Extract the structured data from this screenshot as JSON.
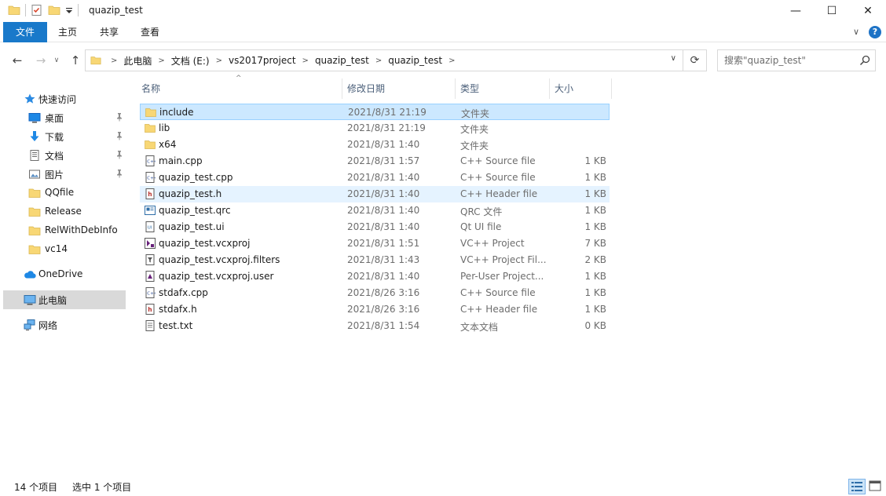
{
  "window": {
    "title": "quazip_test",
    "minimize": "—",
    "maximize": "☐",
    "close": "✕"
  },
  "ribbon": {
    "tabs": [
      "文件",
      "主页",
      "共享",
      "查看"
    ],
    "collapse_glyph": "∨",
    "help_glyph": "?"
  },
  "nav": {
    "back": "←",
    "forward": "→",
    "recent": "∨",
    "up": "↑",
    "refresh": "⟳",
    "address_dropdown": "∨",
    "breadcrumbs": [
      "此电脑",
      "文档 (E:)",
      "vs2017project",
      "quazip_test",
      "quazip_test"
    ],
    "search_placeholder": "搜索\"quazip_test\""
  },
  "sidebar": {
    "quick_access": "快速访问",
    "pinned": [
      {
        "label": "桌面",
        "icon": "desktop-icon"
      },
      {
        "label": "下载",
        "icon": "download-icon"
      },
      {
        "label": "文档",
        "icon": "documents-icon"
      },
      {
        "label": "图片",
        "icon": "pictures-icon"
      }
    ],
    "folders": [
      "QQfile",
      "Release",
      "RelWithDebInfo",
      "vc14"
    ],
    "onedrive": "OneDrive",
    "this_pc": "此电脑",
    "network": "网络"
  },
  "columns": {
    "name": "名称",
    "date": "修改日期",
    "type": "类型",
    "size": "大小"
  },
  "files": [
    {
      "name": "include",
      "date": "2021/8/31 21:19",
      "type": "文件夹",
      "size": "",
      "icon": "folder-icon"
    },
    {
      "name": "lib",
      "date": "2021/8/31 21:19",
      "type": "文件夹",
      "size": "",
      "icon": "folder-icon"
    },
    {
      "name": "x64",
      "date": "2021/8/31 1:40",
      "type": "文件夹",
      "size": "",
      "icon": "folder-icon"
    },
    {
      "name": "main.cpp",
      "date": "2021/8/31 1:57",
      "type": "C++ Source file",
      "size": "1 KB",
      "icon": "cpp-file-icon"
    },
    {
      "name": "quazip_test.cpp",
      "date": "2021/8/31 1:40",
      "type": "C++ Source file",
      "size": "1 KB",
      "icon": "cpp-file-icon"
    },
    {
      "name": "quazip_test.h",
      "date": "2021/8/31 1:40",
      "type": "C++ Header file",
      "size": "1 KB",
      "icon": "header-file-icon"
    },
    {
      "name": "quazip_test.qrc",
      "date": "2021/8/31 1:40",
      "type": "QRC 文件",
      "size": "1 KB",
      "icon": "qrc-file-icon"
    },
    {
      "name": "quazip_test.ui",
      "date": "2021/8/31 1:40",
      "type": "Qt UI file",
      "size": "1 KB",
      "icon": "ui-file-icon"
    },
    {
      "name": "quazip_test.vcxproj",
      "date": "2021/8/31 1:51",
      "type": "VC++ Project",
      "size": "7 KB",
      "icon": "vcxproj-file-icon"
    },
    {
      "name": "quazip_test.vcxproj.filters",
      "date": "2021/8/31 1:43",
      "type": "VC++ Project Fil...",
      "size": "2 KB",
      "icon": "filters-file-icon"
    },
    {
      "name": "quazip_test.vcxproj.user",
      "date": "2021/8/31 1:40",
      "type": "Per-User Project...",
      "size": "1 KB",
      "icon": "user-file-icon"
    },
    {
      "name": "stdafx.cpp",
      "date": "2021/8/26 3:16",
      "type": "C++ Source file",
      "size": "1 KB",
      "icon": "cpp-file-icon"
    },
    {
      "name": "stdafx.h",
      "date": "2021/8/26 3:16",
      "type": "C++ Header file",
      "size": "1 KB",
      "icon": "header-file-icon"
    },
    {
      "name": "test.txt",
      "date": "2021/8/31 1:54",
      "type": "文本文档",
      "size": "0 KB",
      "icon": "text-file-icon"
    }
  ],
  "status": {
    "count": "14 个项目",
    "selected": "选中 1 个项目"
  },
  "colors": {
    "accent": "#1979ca",
    "selection": "#cce8ff",
    "hover": "#e5f3ff",
    "folder": "#f8d775"
  }
}
